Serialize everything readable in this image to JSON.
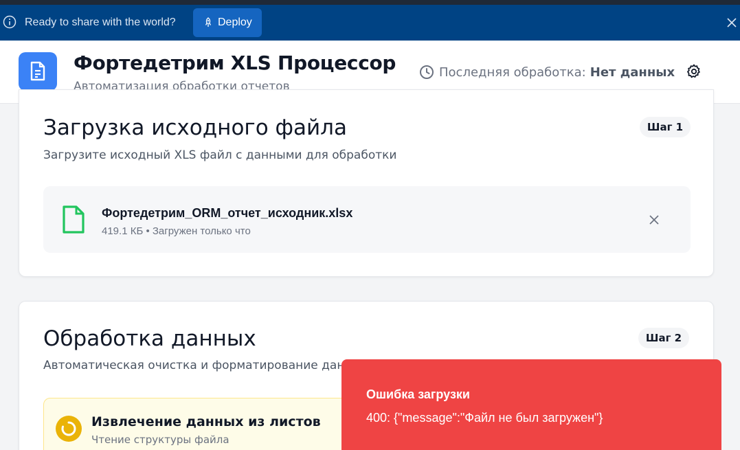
{
  "banner": {
    "text": "Ready to share with the world?",
    "deploy_label": "Deploy"
  },
  "header": {
    "title": "Фортедетрим XLS Процессор",
    "subtitle": "Автоматизация обработки отчетов",
    "last_processing_label": "Последняя обработка:",
    "last_processing_value": "Нет данных"
  },
  "upload_card": {
    "title": "Загрузка исходного файла",
    "description": "Загрузите исходный XLS файл с данными для обработки",
    "step": "Шаг 1",
    "file": {
      "name": "Фортедетрим_ORM_отчет_исходник.xlsx",
      "meta": "419.1 КБ • Загружен только что"
    }
  },
  "processing_card": {
    "title": "Обработка данных",
    "description": "Автоматическая очистка и форматирование данных",
    "step": "Шаг 2",
    "status": {
      "title": "Извлечение данных из листов",
      "subtitle": "Чтение структуры файла"
    }
  },
  "toast": {
    "title": "Ошибка загрузки",
    "message": "400: {\"message\":\"Файл не был загружен\"}"
  },
  "colors": {
    "banner_bg": "#004384",
    "deploy_bg": "#1565c0",
    "accent": "#3b82f6",
    "file_icon": "#22c55e",
    "spinner": "#eab308",
    "toast_bg": "#ef4444"
  },
  "icons": {
    "banner_info": "info-icon",
    "deploy": "rocket-icon",
    "banner_close": "close-icon",
    "logo": "document-icon",
    "clock": "clock-icon",
    "settings": "gear-icon",
    "file": "file-icon",
    "file_remove": "close-icon",
    "spinner": "spinner-icon"
  }
}
